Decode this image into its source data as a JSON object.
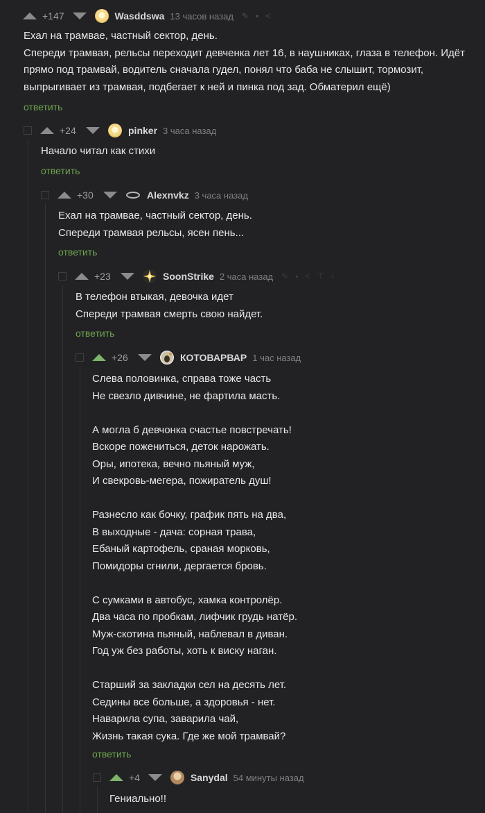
{
  "reply_label": "ответить",
  "colors": {
    "accent_green": "#6da34d",
    "upvoted": "#7db36b",
    "background": "#222224"
  },
  "comments": [
    {
      "rating": "+147",
      "username": "Wasddswa",
      "time": "13 часов назад",
      "avatar": "sun-avatar-icon",
      "lines": [
        "Ехал на трамвае, частный сектор, день.",
        "Спереди трамвая, рельсы переходит девченка лет 16, в наушниках, глаза в телефон. Идёт прямо под трамвай, водитель сначала гудел, понял что баба не слышит, тормозит, выпрыгивает из трамвая, подбегает к ней и пинка под зад. Обматерил ещё)"
      ]
    },
    {
      "rating": "+24",
      "username": "pinker",
      "time": "3 часа назад",
      "avatar": "sun-avatar-icon",
      "lines": [
        "Начало читал как стихи"
      ]
    },
    {
      "rating": "+30",
      "username": "Alexnvkz",
      "time": "3 часа назад",
      "avatar": "ring-avatar-icon",
      "lines": [
        "Ехал на трамвае, частный сектор, день.",
        "Спереди трамвая рельсы, ясен пень..."
      ]
    },
    {
      "rating": "+23",
      "username": "SoonStrike",
      "time": "2 часа назад",
      "avatar": "star-avatar-icon",
      "lines": [
        "В телефон втыкая, девочка идет",
        "Спереди трамвая смерть свою найдет."
      ]
    },
    {
      "rating": "+26",
      "username": "КОТОВАРВАР",
      "time": "1 час назад",
      "avatar": "cat-avatar-icon",
      "upvoted": true,
      "lines": [
        "Слева половинка, справа тоже часть",
        "Не свезло дивчине, не фартила масть.",
        "",
        "А могла б девчонка счастье повстречать!",
        "Вскоре пожениться, деток нарожать.",
        "Оры, ипотека, вечно пьяный муж,",
        "И свекровь-мегера, пожиратель душ!",
        "",
        "Разнесло как бочку, график пять на два,",
        "В выходные - дача: сорная трава,",
        "Ебаный картофель, сраная морковь,",
        "Помидоры сгнили, дергается бровь.",
        "",
        "С сумками в автобус, хамка контролёр.",
        "Два часа по пробкам, лифчик грудь натёр.",
        "Муж-скотина пьяный, наблевал в диван.",
        "Год уж без работы, хоть к виску наган.",
        "",
        "Старший за закладки сел на десять лет.",
        "Седины все больше, а здоровья - нет.",
        "Наварила супа, заварила чай,",
        "Жизнь такая сука. Где же мой трамвай?"
      ]
    },
    {
      "rating": "+4",
      "username": "Sanydal",
      "time": "54 минуты назад",
      "avatar": "photo-avatar-icon",
      "upvoted": true,
      "lines": [
        "Гениально!!"
      ]
    }
  ]
}
